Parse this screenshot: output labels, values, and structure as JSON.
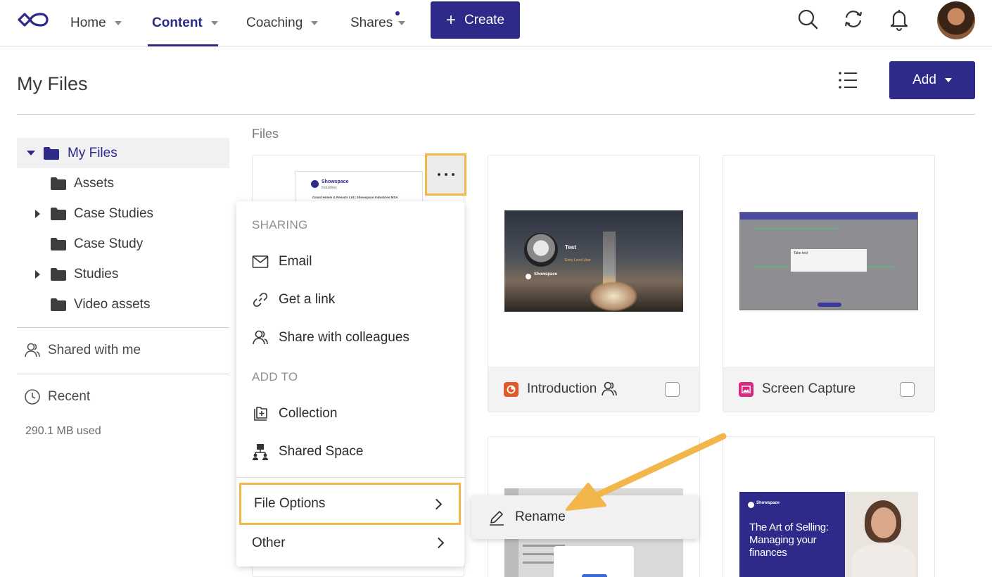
{
  "nav": {
    "items": [
      {
        "label": "Home"
      },
      {
        "label": "Content"
      },
      {
        "label": "Coaching"
      },
      {
        "label": "Shares"
      }
    ],
    "create_label": "Create",
    "accent_color": "#2d2a8a"
  },
  "header": {
    "title": "My Files",
    "add_label": "Add"
  },
  "sidebar": {
    "tree": [
      {
        "label": "My Files",
        "expanded": true,
        "selected": true
      },
      {
        "label": "Assets"
      },
      {
        "label": "Case Studies",
        "expandable": true
      },
      {
        "label": "Case Study"
      },
      {
        "label": "Studies",
        "expandable": true
      },
      {
        "label": "Video assets"
      }
    ],
    "shared_label": "Shared with me",
    "recent_label": "Recent",
    "usage": "290.1 MB used"
  },
  "files": {
    "section_label": "Files",
    "cards": [
      {
        "name": "Introduction",
        "type_icon": "presentation-icon",
        "type_color": "#e0592a",
        "shared": true
      },
      {
        "name": "Screen Capture",
        "type_icon": "image-icon",
        "type_color": "#d6297f",
        "shared": false
      }
    ],
    "thumb_text": {
      "brand": "Showspace",
      "brand_sub": "Industries",
      "doc_line": "Grand Hotels & Resorts Ltd | Showspace Industries MSA",
      "astro_name": "Test",
      "astro_title": "Entry Level User",
      "dialog_title": "Take test",
      "promo_title": "The Art of Selling: Managing your finances"
    }
  },
  "context_menu": {
    "sharing_head": "SHARING",
    "email": "Email",
    "get_link": "Get a link",
    "share_colleagues": "Share with colleagues",
    "add_to_head": "ADD TO",
    "collection": "Collection",
    "shared_space": "Shared Space",
    "file_options": "File Options",
    "other": "Other",
    "highlight_color": "#f2b64a"
  },
  "submenu": {
    "rename": "Rename"
  }
}
